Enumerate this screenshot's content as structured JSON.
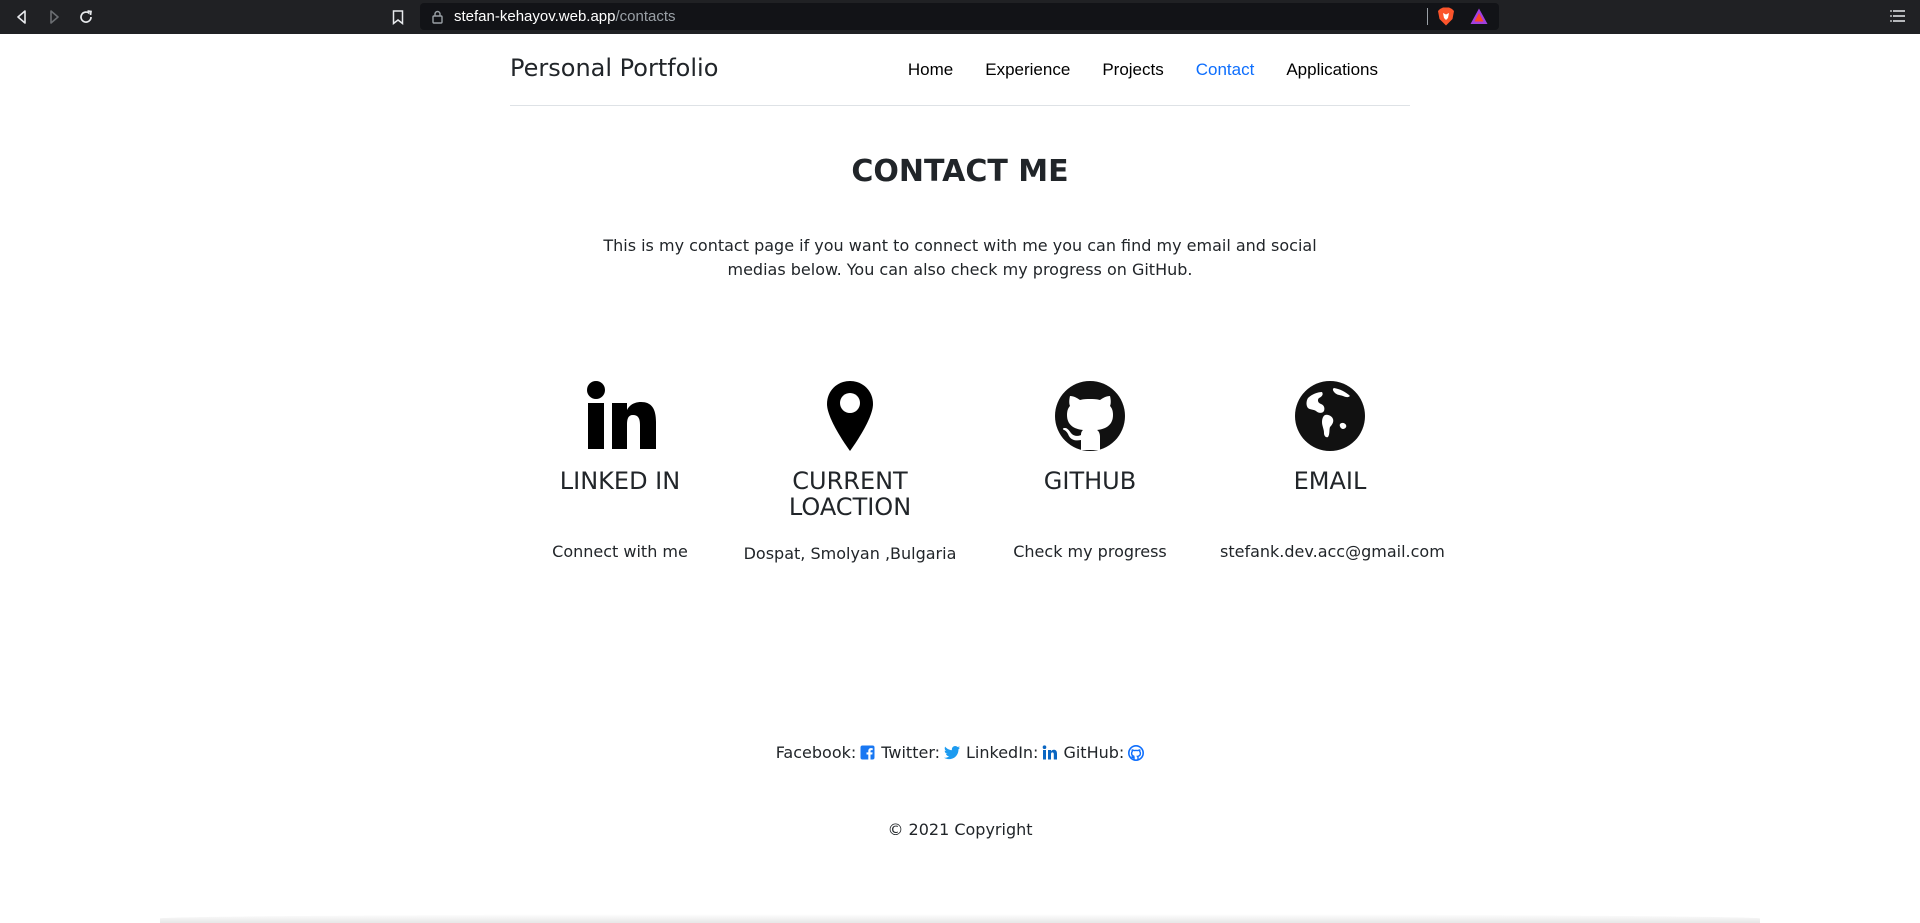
{
  "browser": {
    "url_host": "stefan-kehayov.web.app",
    "url_path": "/contacts"
  },
  "header": {
    "brand": "Personal Portfolio",
    "nav": [
      {
        "label": "Home"
      },
      {
        "label": "Experience"
      },
      {
        "label": "Projects"
      },
      {
        "label": "Contact"
      },
      {
        "label": "Applications"
      }
    ],
    "active_nav": "Contact"
  },
  "main": {
    "title": "CONTACT ME",
    "intro": "This is my contact page if you want to connect with me you can find my email and social medias below. You can also check my progress on GitHub.",
    "cards": [
      {
        "icon": "linkedin-icon",
        "label": "LINKED IN",
        "sub": "Connect with me"
      },
      {
        "icon": "map-pin-icon",
        "label": "CURRENT LOACTION",
        "sub": "Dospat, Smolyan ,Bulgaria"
      },
      {
        "icon": "github-icon",
        "label": "GITHUB",
        "sub": "Check my progress"
      },
      {
        "icon": "globe-icon",
        "label": "EMAIL",
        "sub": "stefank.dev.acc@gmail.com"
      }
    ]
  },
  "footer": {
    "social": [
      {
        "label": "Facebook:",
        "icon": "facebook-icon"
      },
      {
        "label": "Twitter:",
        "icon": "twitter-icon"
      },
      {
        "label": "LinkedIn:",
        "icon": "linkedin-icon"
      },
      {
        "label": "GitHub:",
        "icon": "github-icon"
      }
    ],
    "copyright": "© 2021 Copyright"
  },
  "colors": {
    "chrome_bg": "#202124",
    "link_active": "#0d6efd",
    "social_icon": "#1877f2",
    "text": "#212529"
  }
}
